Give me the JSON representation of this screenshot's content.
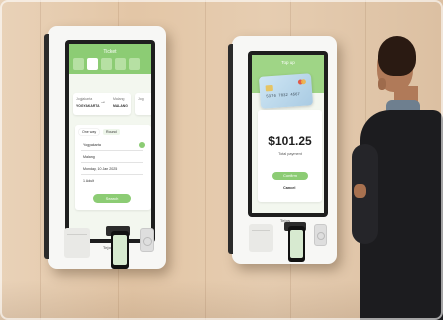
{
  "left_kiosk": {
    "brand": "Tejos",
    "screen": {
      "header_title": "Ticket",
      "route_from_label": "Jogjakarta",
      "route_to_label": "Malang",
      "route_from_code": "YOGYAKARTA",
      "route_to_code": "MALANG",
      "route_side_label": "Jog",
      "tab_oneway": "One way",
      "tab_round": "Round",
      "field_from": "Yogyakarta",
      "field_to": "Malang",
      "field_date": "Monday, 10 Jan 2025",
      "field_passengers": "1 Adult",
      "search_button": "Search"
    }
  },
  "right_kiosk": {
    "brand": "Tejos",
    "screen": {
      "header_title": "Top up",
      "card_number": "5376 7832 4567",
      "amount": "$101.25",
      "amount_sub": "Total payment",
      "confirm_button": "Confirm",
      "cancel_link": "Cancel"
    }
  },
  "colors": {
    "accent_green": "#8ccc74",
    "wall_wood": "#e3c6a6",
    "kiosk_body": "#f7f7f5",
    "suit": "#1c1c1f"
  }
}
